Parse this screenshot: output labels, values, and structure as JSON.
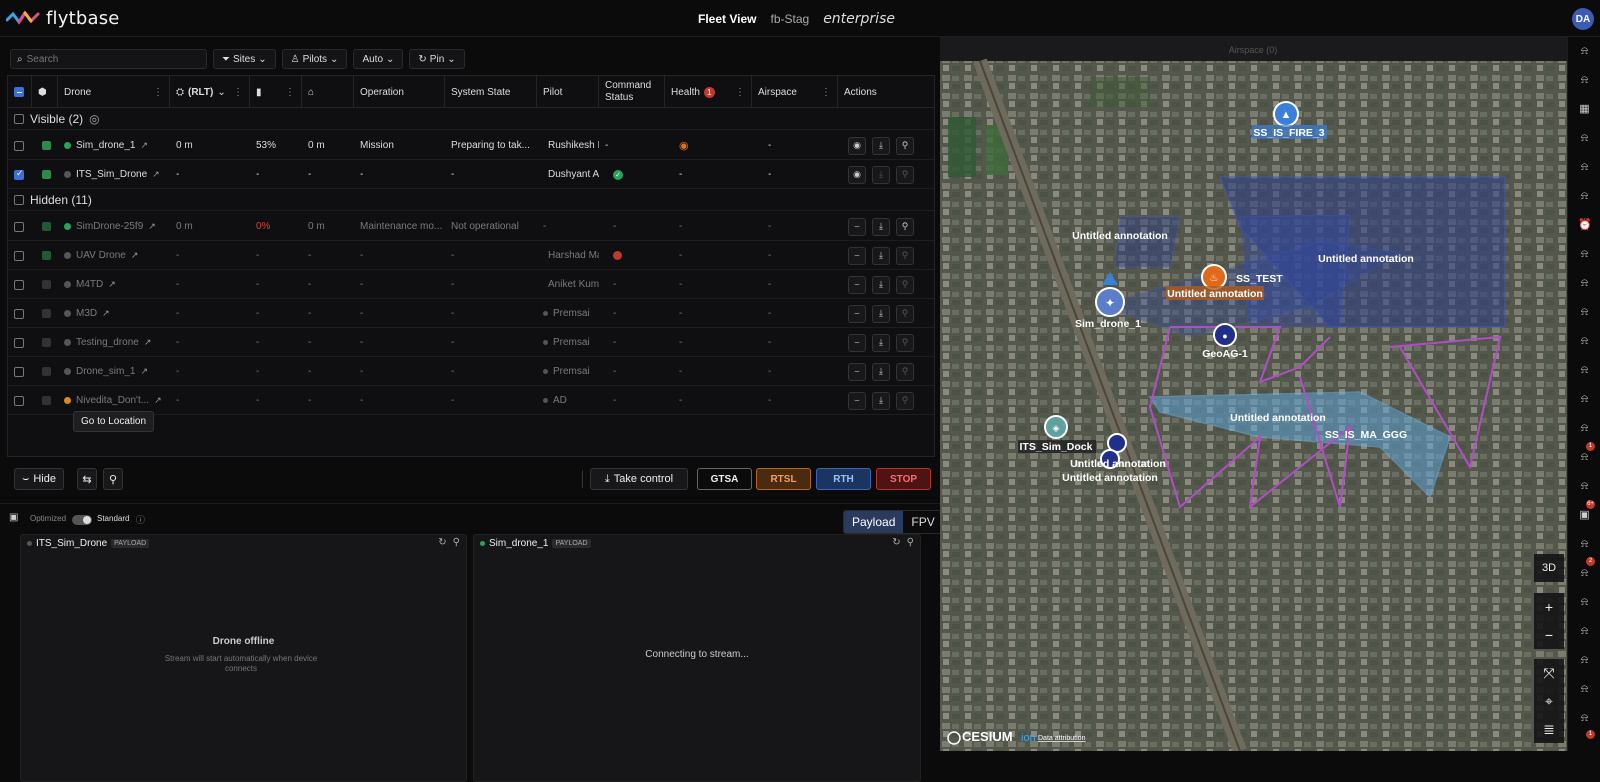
{
  "header": {
    "logo": "flytbase",
    "title": "Fleet View",
    "environment": "fb-Stag",
    "edition": "enterprise",
    "user_initials": "DA"
  },
  "filters": {
    "search_placeholder": "Search",
    "sites": "Sites",
    "pilots": "Pilots",
    "auto": "Auto",
    "pin": "Pin"
  },
  "table": {
    "columns": {
      "drone": "Drone",
      "rlt": "(RLT)",
      "operation": "Operation",
      "system_state": "System State",
      "pilot": "Pilot",
      "command_status": "Command Status",
      "health": "Health",
      "health_badge": "1",
      "airspace": "Airspace",
      "actions": "Actions"
    },
    "visible_group": "Visible (2)",
    "hidden_group": "Hidden (11)",
    "visible_rows": [
      {
        "name": "Sim_drone_1",
        "rlt": "0 m",
        "battery": "53%",
        "home": "0 m",
        "operation": "Mission",
        "state": "Preparing to tak...",
        "pilot": "Rushikesh I",
        "command": "-",
        "health": "",
        "airspace": "-"
      },
      {
        "name": "ITS_Sim_Drone",
        "rlt": "-",
        "battery": "-",
        "home": "-",
        "operation": "-",
        "state": "-",
        "pilot": "Dushyant A",
        "command": "",
        "health": "-",
        "airspace": "-"
      }
    ],
    "hidden_rows": [
      {
        "name": "SimDrone-25f9",
        "rlt": "0 m",
        "battery": "0%",
        "home": "0 m",
        "operation": "Maintenance mo...",
        "state": "Not operational",
        "pilot": "-",
        "command": "-",
        "health": "-",
        "airspace": "-"
      },
      {
        "name": "UAV Drone",
        "rlt": "-",
        "battery": "-",
        "home": "-",
        "operation": "-",
        "state": "-",
        "pilot": "Harshad Ma",
        "command": "",
        "health": "-",
        "airspace": "-"
      },
      {
        "name": "M4TD",
        "rlt": "-",
        "battery": "-",
        "home": "-",
        "operation": "-",
        "state": "-",
        "pilot": "Aniket Kum",
        "command": "-",
        "health": "-",
        "airspace": "-"
      },
      {
        "name": "M3D",
        "rlt": "-",
        "battery": "-",
        "home": "-",
        "operation": "-",
        "state": "-",
        "pilot": "Premsai",
        "command": "-",
        "health": "-",
        "airspace": "-"
      },
      {
        "name": "Testing_drone",
        "rlt": "-",
        "battery": "-",
        "home": "-",
        "operation": "-",
        "state": "-",
        "pilot": "Premsai",
        "command": "-",
        "health": "-",
        "airspace": "-"
      },
      {
        "name": "Drone_sim_1",
        "rlt": "-",
        "battery": "-",
        "home": "-",
        "operation": "-",
        "state": "-",
        "pilot": "Premsai",
        "command": "-",
        "health": "-",
        "airspace": "-"
      },
      {
        "name": "Nivedita_Don't...",
        "rlt": "-",
        "battery": "-",
        "home": "-",
        "operation": "-",
        "state": "-",
        "pilot": "AD",
        "command": "-",
        "health": "-",
        "airspace": "-"
      }
    ]
  },
  "tooltip": "Go to Location",
  "controls": {
    "hide": "Hide",
    "take_control": "Take control",
    "gtsa": "GTSA",
    "rtsl": "RTSL",
    "rth": "RTH",
    "stop": "STOP"
  },
  "streams": {
    "optimized": "Optimized",
    "standard": "Standard",
    "payload": "Payload",
    "fpv": "FPV",
    "tag": "PAYLOAD",
    "left": {
      "name": "ITS_Sim_Drone",
      "title": "Drone offline",
      "sub": "Stream will start automatically when device connects"
    },
    "right": {
      "name": "Sim_drone_1",
      "title": "Connecting to stream..."
    }
  },
  "map": {
    "airspace": "Airspace (0)",
    "labels": {
      "fire": "SS_IS_FIRE_3",
      "ann1": "Untitled annotation",
      "ss_test": "SS_TEST",
      "ann2": "Untitled annotation",
      "ann3": "Untitled annotation",
      "sim_dock": "Sim_drone_1",
      "geo": "GeoAG-1",
      "ann4": "Untitled annotation",
      "ma": "SS_IS_MA_GGG",
      "its_dock": "ITS_Sim_Dock",
      "ann5": "Untitled annotation",
      "ann6": "Untitled annotation"
    },
    "btn_3d": "3D",
    "cesium": "CESIUM",
    "ion": "ion",
    "attribution": "Data attribution"
  },
  "rail_badges": [
    "1",
    "6+",
    "2",
    "1"
  ]
}
